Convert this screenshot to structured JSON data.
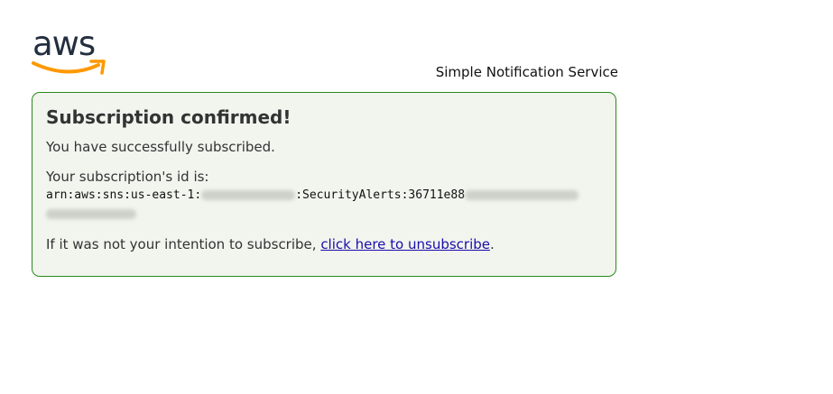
{
  "header": {
    "logo_text": "aws",
    "service_name": "Simple Notification Service"
  },
  "panel": {
    "title": "Subscription confirmed!",
    "message": "You have successfully subscribed.",
    "id_label": "Your subscription's id is:",
    "arn_prefix": "arn:aws:sns:us-east-1:",
    "arn_topic": ":SecurityAlerts:36711e88",
    "unsubscribe_text": "If it was not your intention to subscribe, ",
    "unsubscribe_link": "click here to unsubscribe",
    "unsubscribe_suffix": "."
  },
  "colors": {
    "panel_border": "#2a8a1c",
    "panel_background": "#f1f5ee",
    "link": "#1a0dab",
    "aws_orange": "#ff9900",
    "aws_dark": "#232f3e"
  }
}
